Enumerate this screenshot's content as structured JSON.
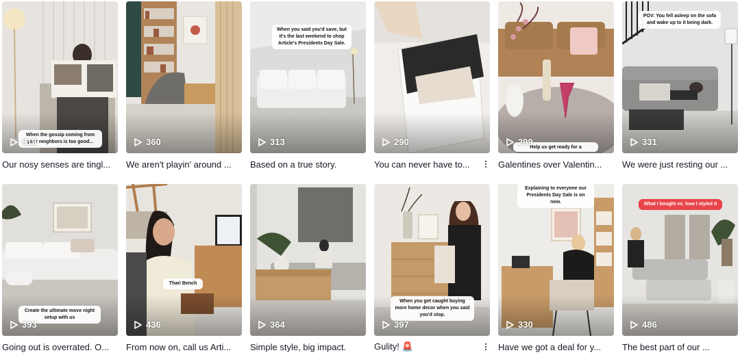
{
  "videos": [
    {
      "views": "919",
      "caption": "Our nosy senses are tingl...",
      "overlay": "When the gossip coming from your neighbors is too good..."
    },
    {
      "views": "360",
      "caption": "We aren't playin' around ...",
      "overlay": ""
    },
    {
      "views": "313",
      "caption": "Based on a true story.",
      "overlay": "When you said you'd save, but it's the last weekend to shop Article's Presidents Day Sale."
    },
    {
      "views": "290",
      "caption": "You can never have to...",
      "overlay": ""
    },
    {
      "views": "299",
      "caption": "Galentines over Valentin...",
      "overlay": "Help us get ready for a Galentines party"
    },
    {
      "views": "331",
      "caption": "We were just resting our ...",
      "overlay": "POV: You fell asleep on the sofa and wake up to it being dark."
    },
    {
      "views": "393",
      "caption": "Going out is overrated. O...",
      "overlay": "Create the ultimate move night setup with us"
    },
    {
      "views": "436",
      "caption": "From now on, call us Arti...",
      "overlay": "Thari Bench"
    },
    {
      "views": "364",
      "caption": "Simple style, big impact.",
      "overlay": ""
    },
    {
      "views": "397",
      "caption": "Gulity! 🚨",
      "overlay": "When you get caught buying more home decor when you said you'd stop."
    },
    {
      "views": "330",
      "caption": "Have we got a deal for y...",
      "overlay": "Explaining to everyone our Presidents Day Sale is on now."
    },
    {
      "views": "486",
      "caption": "The best part of our ...",
      "overlay": "What I bought vs. how I styled it"
    }
  ],
  "icons": {
    "play": "play-icon",
    "more": "more-options-icon"
  },
  "colors": {
    "text": "#161823",
    "badge_red": "#e8454a"
  }
}
